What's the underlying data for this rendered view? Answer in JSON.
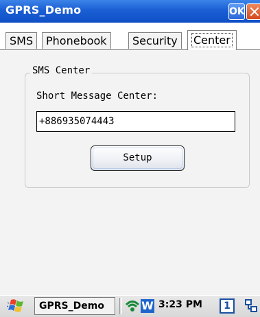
{
  "window": {
    "title": "GPRS_Demo",
    "ok_label": "OK"
  },
  "tabs": [
    {
      "label": "SMS"
    },
    {
      "label": "Phonebook"
    },
    {
      "label": "Security"
    },
    {
      "label": "Center",
      "active": true
    }
  ],
  "sms_center": {
    "group_label": "SMS Center",
    "field_label": "Short Message Center:",
    "field_value": "+886935074443",
    "setup_label": "Setup"
  },
  "taskbar": {
    "task_label": "GPRS_Demo",
    "w_label": "W",
    "clock": "3:23 PM",
    "ime_label": "1"
  },
  "colors": {
    "titlebar": "#1b5fd4",
    "panel": "#f3f3f3"
  },
  "icons": [
    "close-icon",
    "windows-start-icon",
    "wifi-icon",
    "network-icon"
  ]
}
